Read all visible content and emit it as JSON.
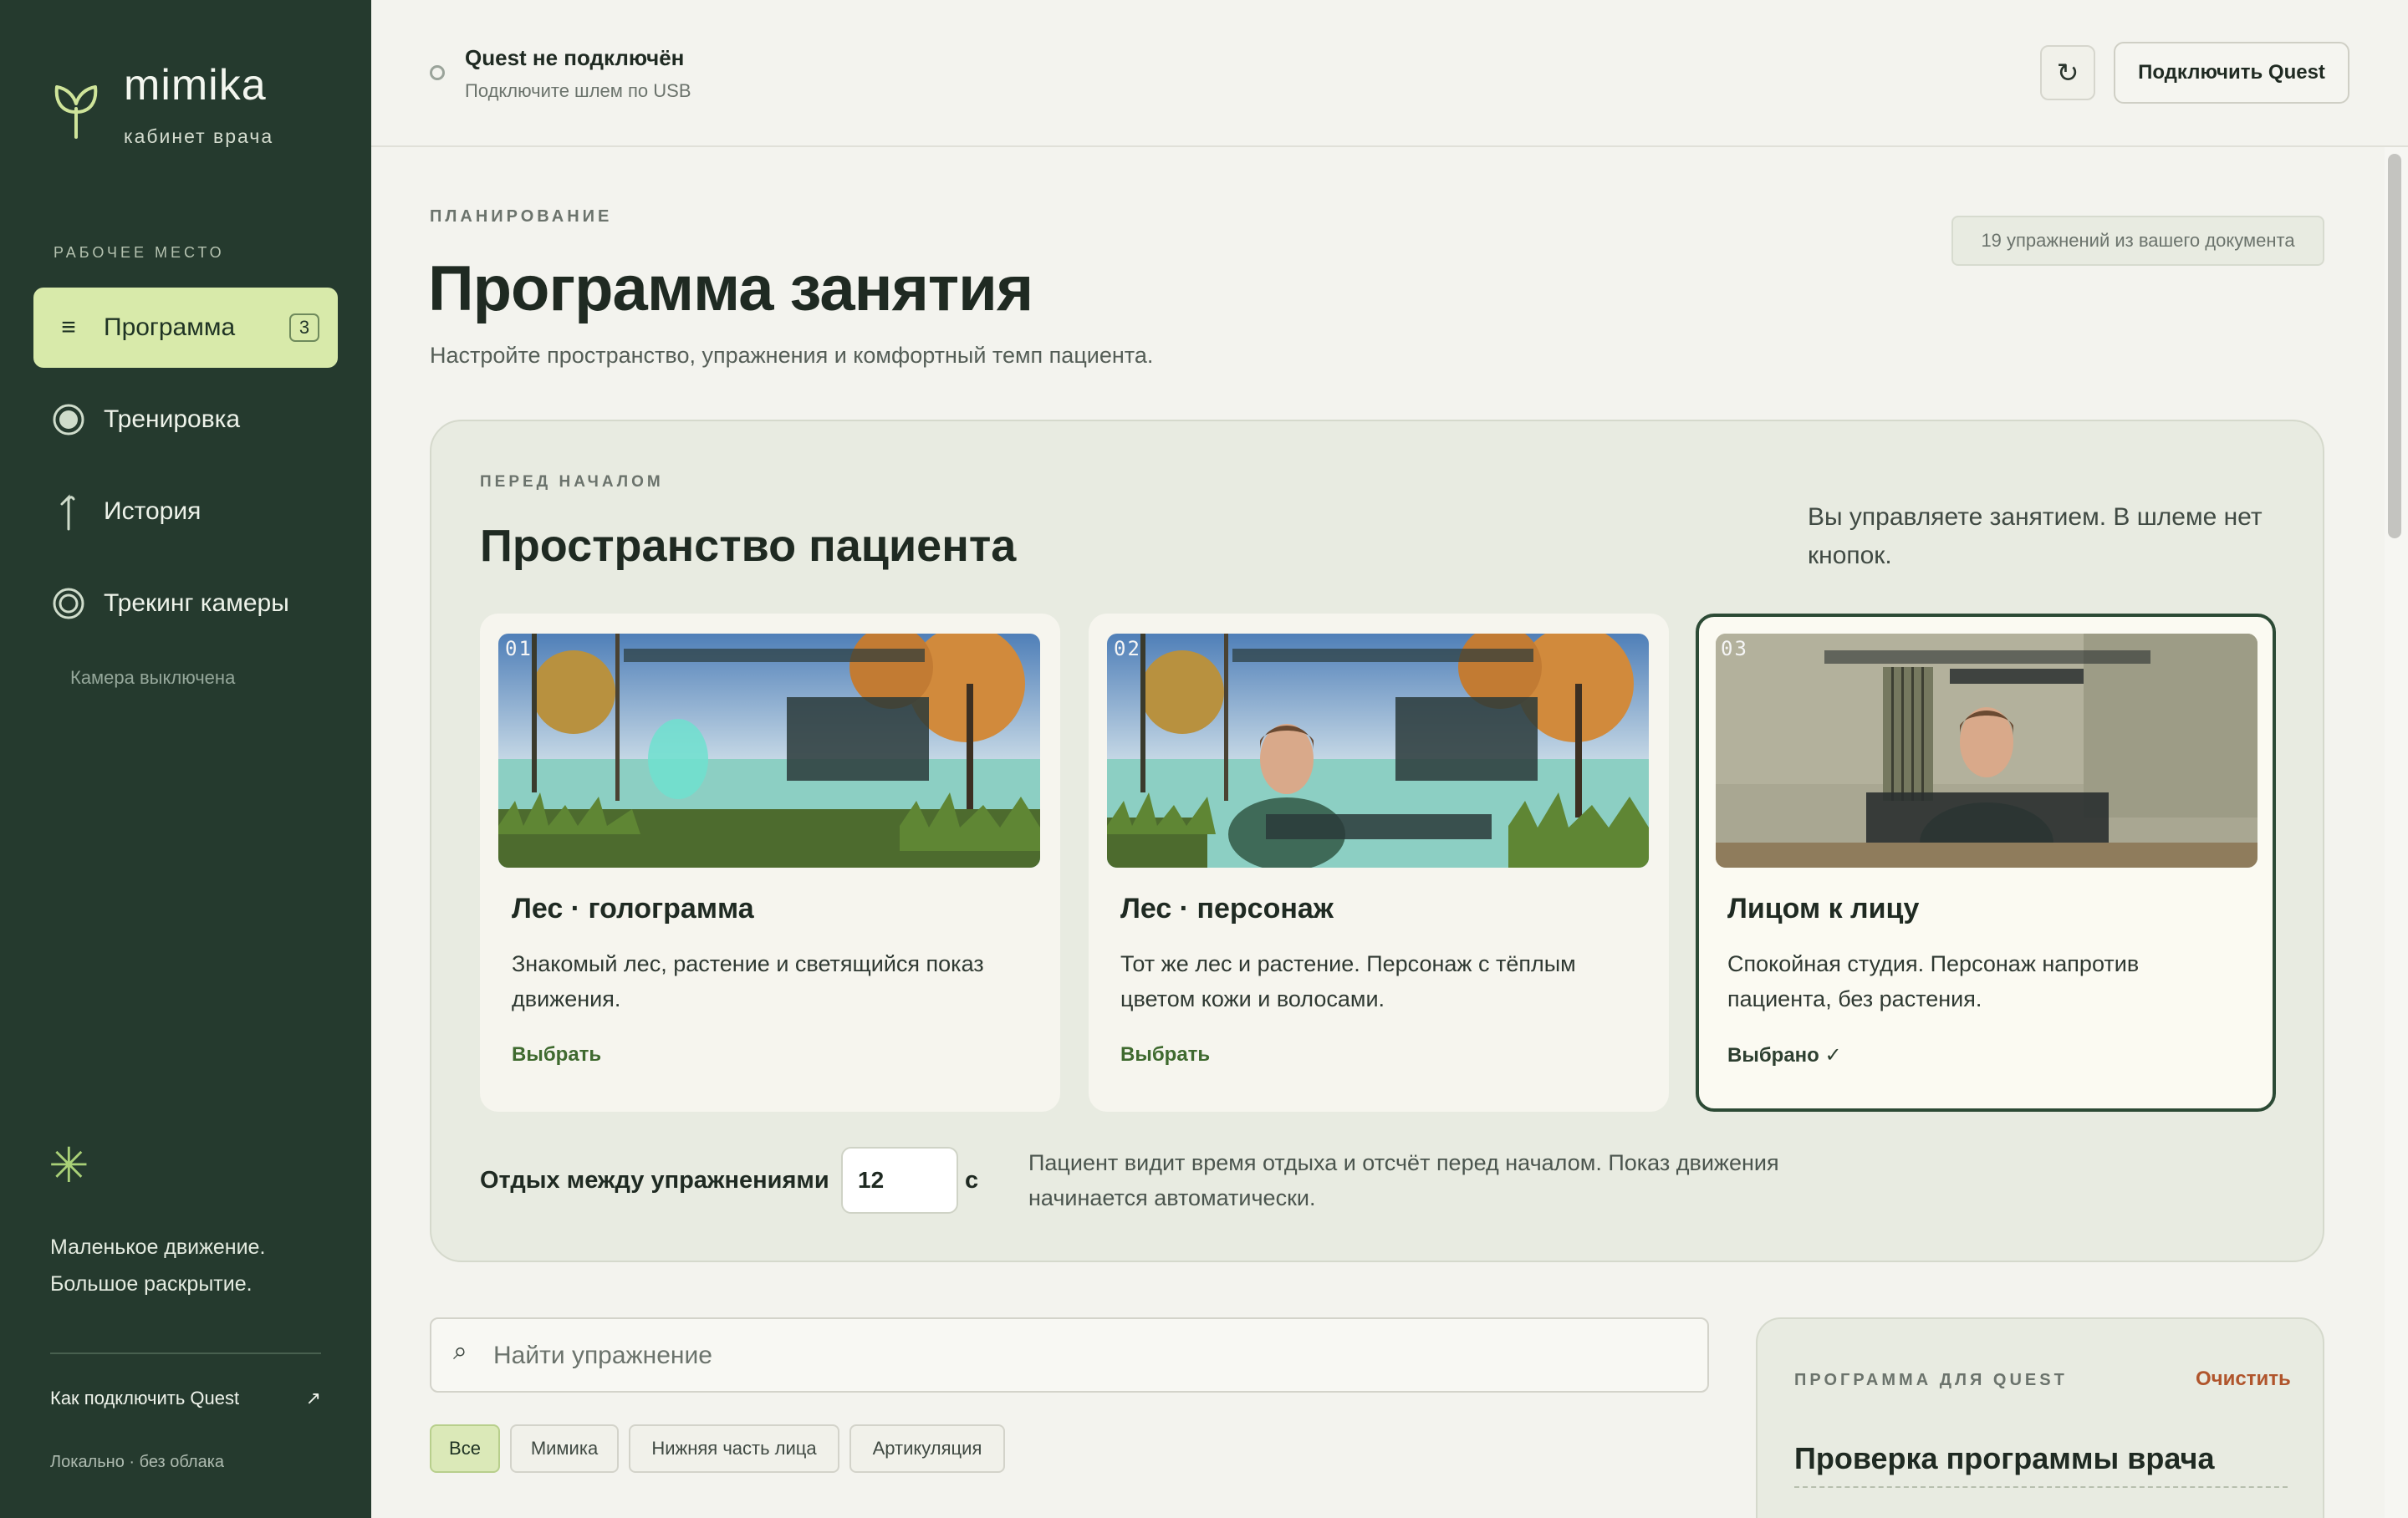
{
  "sidebar": {
    "brand_name": "mimika",
    "brand_sub": "кабинет врача",
    "section_label": "РАБОЧЕЕ МЕСТО",
    "nav": [
      {
        "label": "Программа",
        "icon": "list-icon",
        "badge": "3",
        "active": true
      },
      {
        "label": "Тренировка",
        "icon": "target-circle-icon"
      },
      {
        "label": "История",
        "icon": "history-icon"
      },
      {
        "label": "Трекинг камеры",
        "icon": "camera-ring-icon"
      }
    ],
    "camera_status": "Камера выключена",
    "slogan_line1": "Маленькое движение.",
    "slogan_line2": "Большое раскрытие.",
    "help_link": "Как подключить Quest",
    "footer_note": "Локально · без облака"
  },
  "topbar": {
    "status_title": "Quest не подключён",
    "status_sub": "Подключите шлем по USB",
    "refresh_icon": "↻",
    "connect_label": "Подключить Quest"
  },
  "page": {
    "eyebrow": "ПЛАНИРОВАНИЕ",
    "title": "Программа занятия",
    "subtitle": "Настройте пространство, упражнения и комфортный темп пациента.",
    "doc_pill": "19 упражнений из вашего документа"
  },
  "space": {
    "eyebrow": "ПЕРЕД НАЧАЛОМ",
    "title": "Пространство пациента",
    "note": "Вы управляете занятием. В шлеме нет кнопок.",
    "cards": [
      {
        "num": "01",
        "title": "Лес · голограмма",
        "desc": "Знакомый лес, растение и светящийся показ движения.",
        "action": "Выбрать"
      },
      {
        "num": "02",
        "title": "Лес · персонаж",
        "desc": "Тот же лес и растение. Персонаж с тёплым цветом кожи и волосами.",
        "action": "Выбрать"
      },
      {
        "num": "03",
        "title": "Лицом к лицу",
        "desc": "Спокойная студия. Персонаж напротив пациента, без растения.",
        "action": "Выбрано ✓",
        "selected": true
      }
    ],
    "rest_label": "Отдых между упражнениями",
    "rest_value": "12",
    "rest_unit": "с",
    "rest_note": "Пациент видит время отдыха и отсчёт перед началом. Показ движения начинается автоматически."
  },
  "search": {
    "placeholder": "Найти упражнение"
  },
  "filters": [
    "Все",
    "Мимика",
    "Нижняя часть лица",
    "Артикуляция"
  ],
  "quest_program": {
    "eyebrow": "ПРОГРАММА ДЛЯ QUEST",
    "clear_label": "Очистить",
    "title": "Проверка программы врача"
  },
  "colors": {
    "sidebar_bg": "#253a2e",
    "accent_active": "#d8eaaa",
    "action_green": "#3f6a2f",
    "clear_orange": "#b0552c"
  }
}
